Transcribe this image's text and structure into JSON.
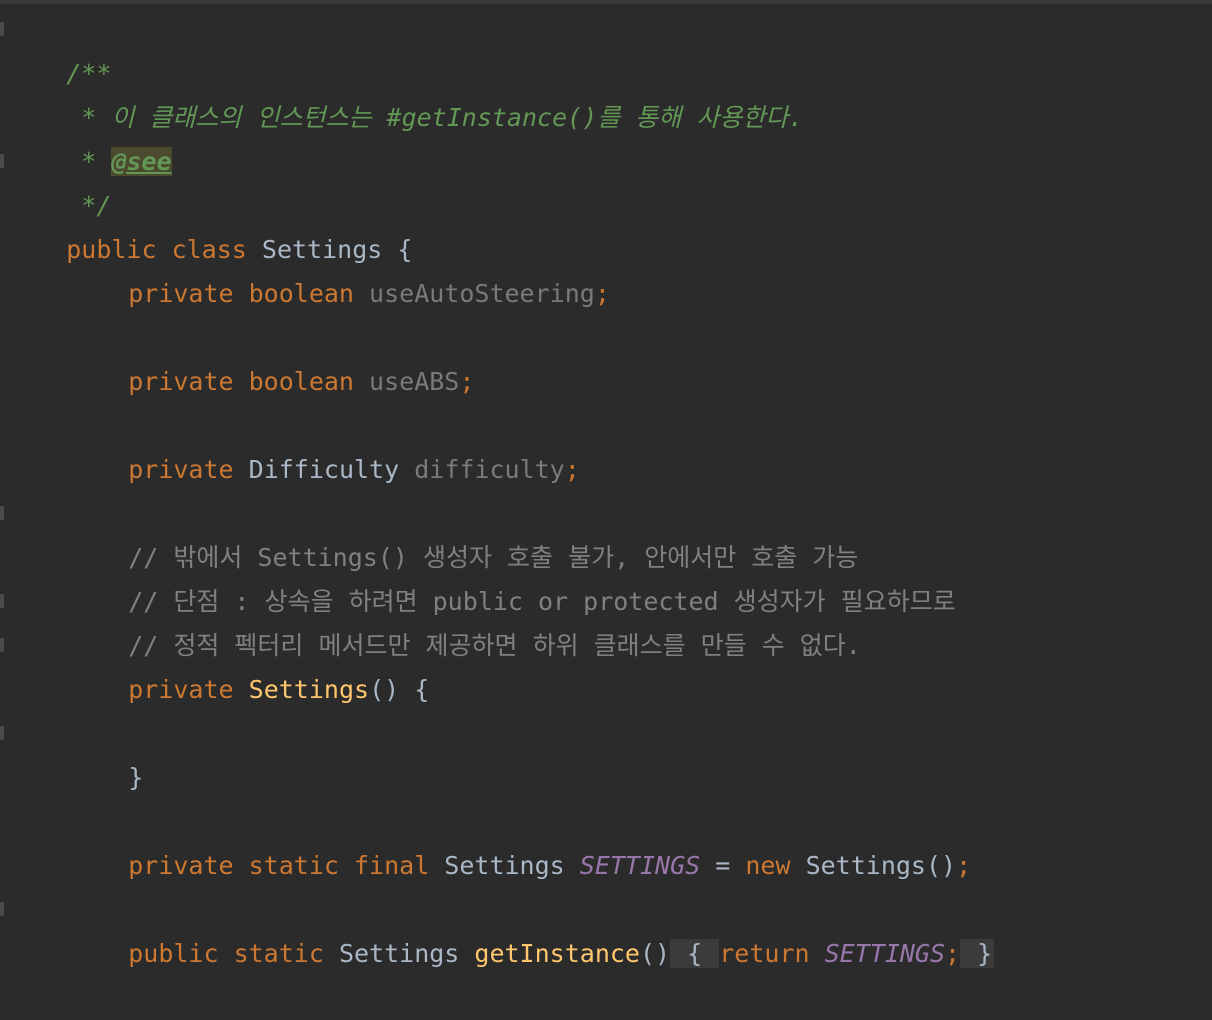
{
  "editor": {
    "language": "java",
    "lines": [
      {
        "id": "doc-open",
        "tokens": [
          {
            "t": "/**",
            "k": "doc"
          }
        ]
      },
      {
        "id": "doc-desc",
        "tokens": [
          {
            "t": " * 이 클래스의 인스턴스는 #getInstance()를 통해 사용한다.",
            "k": "doc"
          }
        ]
      },
      {
        "id": "doc-see",
        "tokens": [
          {
            "t": " * ",
            "k": "doc"
          },
          {
            "t": "@see",
            "k": "doc-tag"
          }
        ]
      },
      {
        "id": "doc-close",
        "tokens": [
          {
            "t": " */",
            "k": "doc"
          }
        ]
      },
      {
        "id": "class-decl",
        "tokens": [
          {
            "t": "public class ",
            "k": "kw"
          },
          {
            "t": "Settings {",
            "k": "plain"
          }
        ]
      },
      {
        "id": "field-auto-steering",
        "indent": 1,
        "tokens": [
          {
            "t": "private boolean ",
            "k": "kw"
          },
          {
            "t": "useAutoSteering",
            "k": "field"
          },
          {
            "t": ";",
            "k": "kw"
          }
        ]
      },
      {
        "id": "field-abs",
        "indent": 1,
        "tokens": [
          {
            "t": "private boolean ",
            "k": "kw"
          },
          {
            "t": "useABS",
            "k": "field"
          },
          {
            "t": ";",
            "k": "kw"
          }
        ]
      },
      {
        "id": "field-difficulty",
        "indent": 1,
        "tokens": [
          {
            "t": "private ",
            "k": "kw"
          },
          {
            "t": "Difficulty ",
            "k": "plain"
          },
          {
            "t": "difficulty",
            "k": "field"
          },
          {
            "t": ";",
            "k": "kw"
          }
        ]
      },
      {
        "id": "comment-1",
        "indent": 1,
        "tokens": [
          {
            "t": "// 밖에서 Settings() 생성자 호출 불가, 안에서만 호출 가능",
            "k": "comment"
          }
        ]
      },
      {
        "id": "comment-2",
        "indent": 1,
        "tokens": [
          {
            "t": "// 단점 : 상속을 하려면 public or protected 생성자가 필요하므로",
            "k": "comment"
          }
        ]
      },
      {
        "id": "comment-3",
        "indent": 1,
        "tokens": [
          {
            "t": "// 정적 펙터리 메서드만 제공하면 하위 클래스를 만들 수 없다.",
            "k": "comment"
          }
        ]
      },
      {
        "id": "ctor-decl",
        "indent": 1,
        "tokens": [
          {
            "t": "private ",
            "k": "kw"
          },
          {
            "t": "Settings",
            "k": "method"
          },
          {
            "t": "() {",
            "k": "plain"
          }
        ]
      },
      {
        "id": "ctor-close",
        "indent": 1,
        "tokens": [
          {
            "t": "}",
            "k": "plain"
          }
        ]
      },
      {
        "id": "singleton-field",
        "indent": 1,
        "tokens": [
          {
            "t": "private static final ",
            "k": "kw"
          },
          {
            "t": "Settings ",
            "k": "plain"
          },
          {
            "t": "SETTINGS",
            "k": "const"
          },
          {
            "t": " = ",
            "k": "plain"
          },
          {
            "t": "new ",
            "k": "kw"
          },
          {
            "t": "Settings()",
            "k": "plain"
          },
          {
            "t": ";",
            "k": "kw"
          }
        ]
      },
      {
        "id": "get-instance",
        "indent": 1,
        "tokens": [
          {
            "t": "public static ",
            "k": "kw"
          },
          {
            "t": "Settings ",
            "k": "plain"
          },
          {
            "t": "getInstance",
            "k": "method"
          },
          {
            "t": "()",
            "k": "plain"
          },
          {
            "t": " { ",
            "k": "fold"
          },
          {
            "t": "return ",
            "k": "kw"
          },
          {
            "t": "SETTINGS",
            "k": "const"
          },
          {
            "t": ";",
            "k": "kw"
          },
          {
            "t": " }",
            "k": "fold"
          }
        ]
      }
    ]
  },
  "theme": {
    "background": "#2b2b2b",
    "keyword": "#cc7832",
    "doc_comment": "#629755",
    "line_comment": "#808080",
    "method": "#ffc66d",
    "constant": "#9876aa",
    "field": "#7a7a7a",
    "default_text": "#a9b7c6"
  }
}
